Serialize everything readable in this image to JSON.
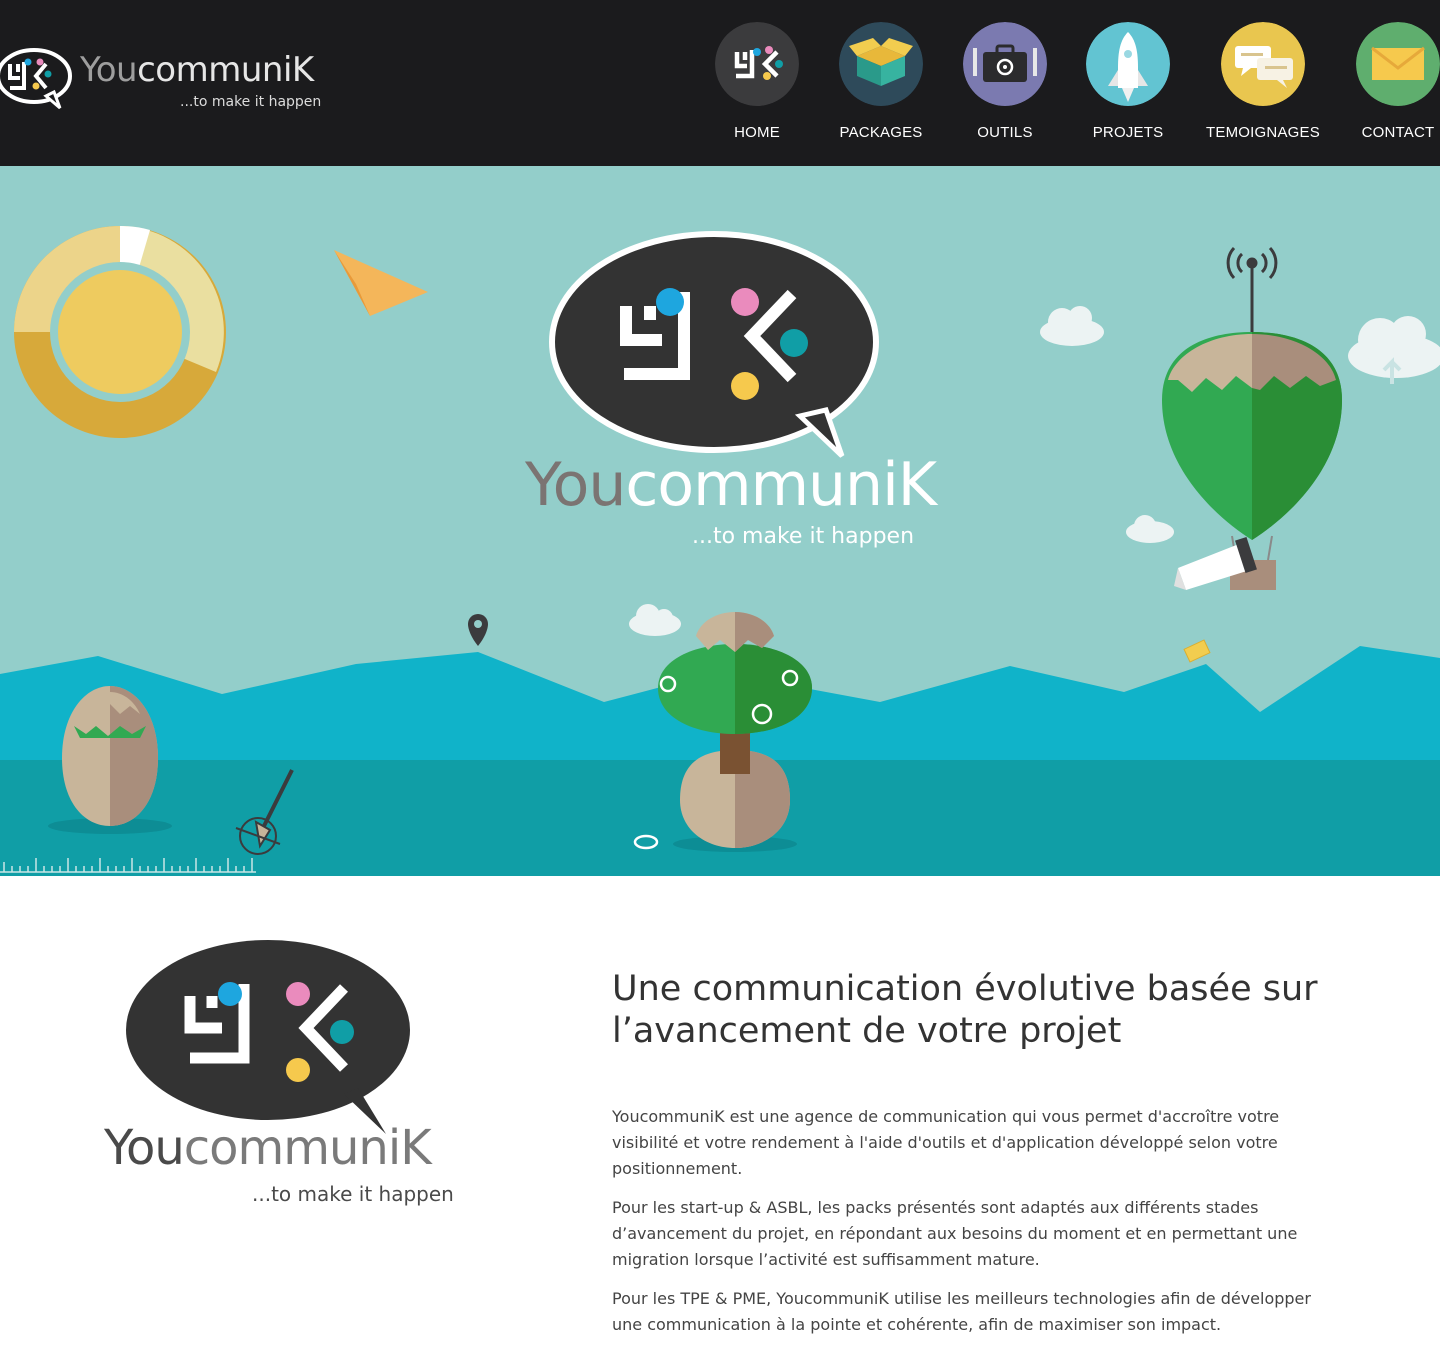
{
  "brand": {
    "name_part1": "You",
    "name_part2": "communiK",
    "tagline": "...to make it happen"
  },
  "nav": {
    "items": [
      {
        "label": "HOME",
        "icon": "logo-icon",
        "color": "#3b3b3d"
      },
      {
        "label": "PACKAGES",
        "icon": "box-icon",
        "color": "#2e4a5a"
      },
      {
        "label": "OUTILS",
        "icon": "toolbox-icon",
        "color": "#7b7ab0"
      },
      {
        "label": "PROJETS",
        "icon": "rocket-icon",
        "color": "#62c4d2"
      },
      {
        "label": "TEMOIGNAGES",
        "icon": "chat-bubbles-icon",
        "color": "#e9c64f"
      },
      {
        "label": "CONTACT",
        "icon": "envelope-icon",
        "color": "#5fae6e"
      }
    ]
  },
  "hero": {
    "name_part1": "You",
    "name_part2": "communiK",
    "tagline": "...to make it happen"
  },
  "intro": {
    "logo_name_part1": "You",
    "logo_name_part2": "communiK",
    "logo_tagline": "...to make it happen",
    "title": "Une communication évolutive basée sur l’avancement de votre projet",
    "paragraphs": [
      "YoucommuniK est une agence de communication qui vous permet d'accroître votre visibilité et votre rendement à l'aide d'outils et d'application développé selon votre positionnement.",
      "Pour les start-up & ASBL, les packs présentés sont adaptés aux différents stades d’avancement du projet, en répondant aux besoins du moment et en permettant une migration lorsque l’activité est suffisamment mature.",
      "Pour les TPE & PME, YoucommuniK utilise les meilleurs technologies afin de développer une communication à la pointe et cohérente, afin de maximiser son impact."
    ]
  },
  "colors": {
    "header_bg": "#1b1b1d",
    "hero_sky": "#93ceca",
    "hero_mountains": "#10b3c9",
    "hero_ground": "#109ea6",
    "logo_dark": "#333333",
    "dot_blue": "#1ea6df",
    "dot_pink": "#ea8bbd",
    "dot_teal": "#109ea6",
    "dot_yellow": "#f6c94d"
  }
}
